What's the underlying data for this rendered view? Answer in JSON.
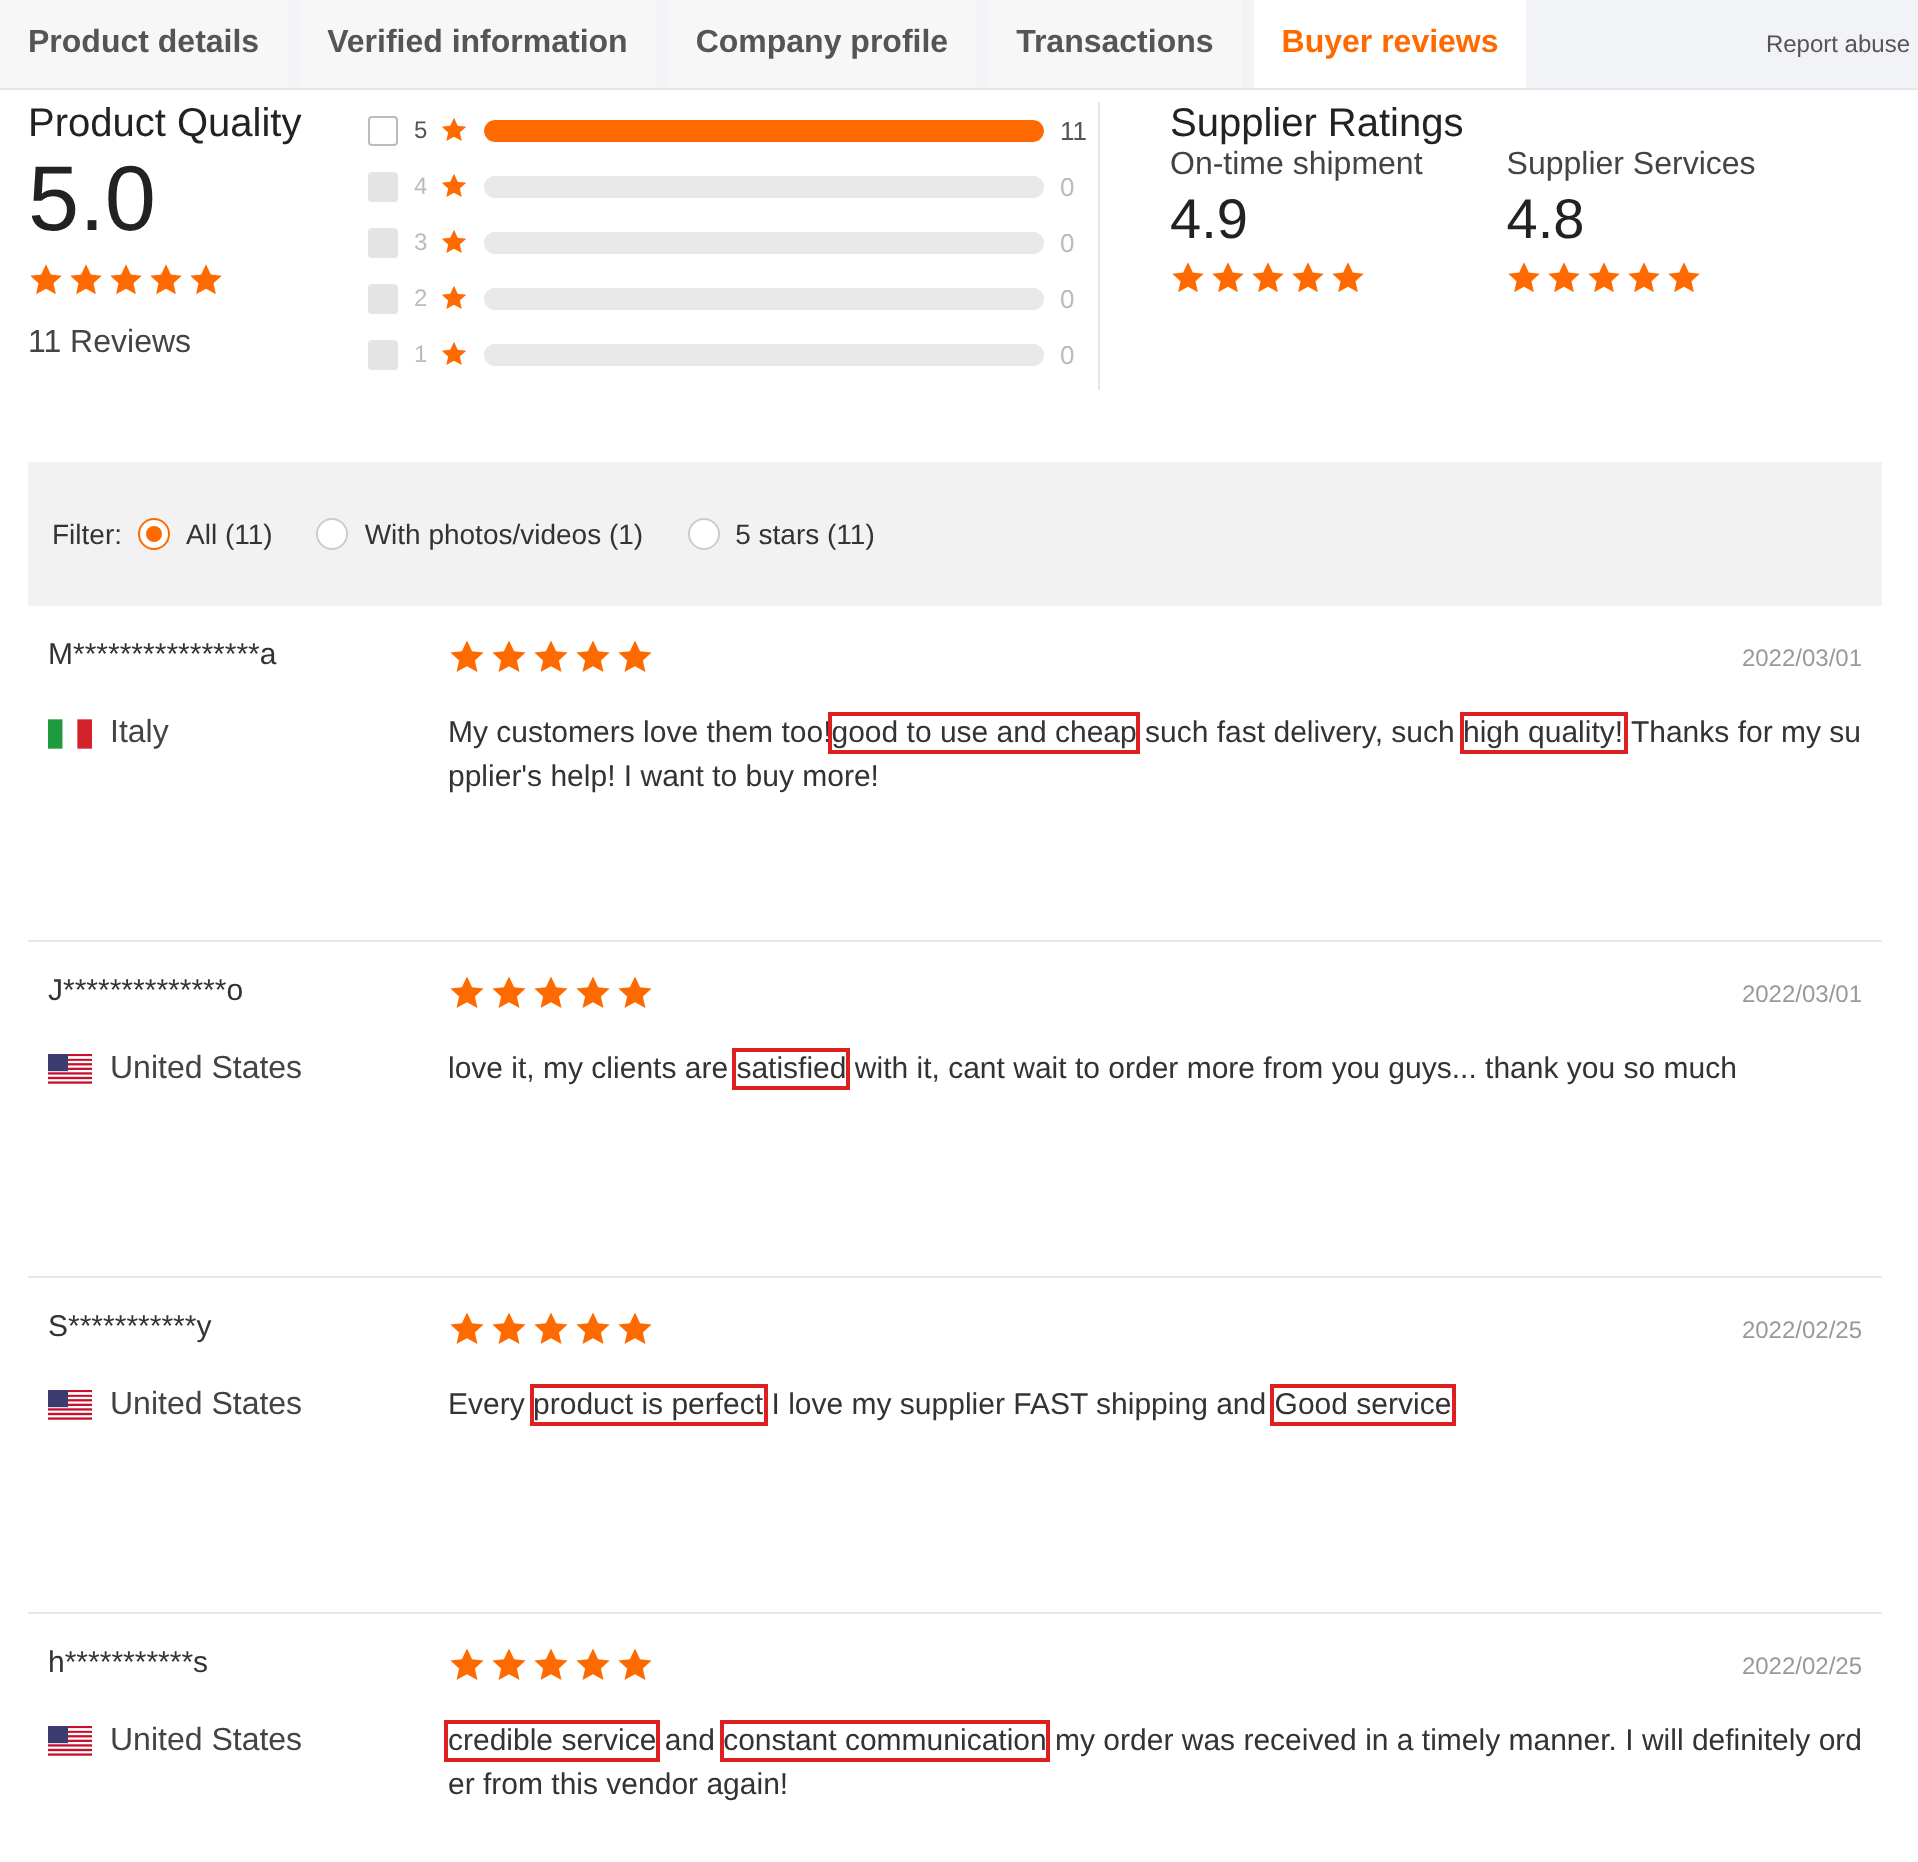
{
  "tabs": [
    {
      "label": "Product details",
      "selected": false
    },
    {
      "label": "Verified information",
      "selected": false
    },
    {
      "label": "Company profile",
      "selected": false
    },
    {
      "label": "Transactions",
      "selected": false
    },
    {
      "label": "Buyer reviews",
      "selected": true
    }
  ],
  "report_link": "Report abuse",
  "product_quality": {
    "title": "Product Quality",
    "score": "5.0",
    "stars": 5,
    "reviews": "11 Reviews"
  },
  "breakdown": [
    {
      "label": "5",
      "checked": false,
      "disabled": false,
      "level": 1,
      "count": "11"
    },
    {
      "label": "4",
      "checked": false,
      "disabled": true,
      "count": "0"
    },
    {
      "label": "3",
      "checked": false,
      "disabled": true,
      "count": "0"
    },
    {
      "label": "2",
      "checked": false,
      "disabled": true,
      "count": "0"
    },
    {
      "label": "1",
      "checked": false,
      "disabled": true,
      "count": "0"
    }
  ],
  "supplier_ratings": {
    "title": "Supplier Ratings",
    "items": [
      {
        "label": "On-time shipment",
        "score": "4.9",
        "stars": 5
      },
      {
        "label": "Supplier Services",
        "score": "4.8",
        "stars": 5
      }
    ]
  },
  "filter": {
    "label": "Filter:",
    "options": [
      {
        "label": "All (11)",
        "selected": true
      },
      {
        "label": "With photos/videos (1)",
        "selected": false
      },
      {
        "label": "5 stars (11)",
        "selected": false
      }
    ]
  },
  "reviews": [
    {
      "name": "M****************a",
      "kind": "italy",
      "country": "Italy",
      "stars": 5,
      "date": "2022/03/01",
      "text": [
        {
          "t": "My customers love them too!",
          "boxed": false
        },
        {
          "t": "good to use and cheap",
          "boxed": true
        },
        {
          "t": " such fast delivery, such ",
          "boxed": false
        },
        {
          "t": "high quality!",
          "boxed": true
        },
        {
          "t": " Thanks for my supplier's help! I want to buy more!",
          "boxed": false
        }
      ]
    },
    {
      "name": "J**************o",
      "kind": "us",
      "country": "United States",
      "stars": 5,
      "date": "2022/03/01",
      "text": [
        {
          "t": "love it, my clients are ",
          "boxed": false
        },
        {
          "t": "satisfied",
          "boxed": true
        },
        {
          "t": " with it, cant wait to order more from you guys... thank you so much",
          "boxed": false
        }
      ]
    },
    {
      "name": "S***********y",
      "kind": "us",
      "country": "United States",
      "stars": 5,
      "date": "2022/02/25",
      "text": [
        {
          "t": "Every ",
          "boxed": false
        },
        {
          "t": "product is perfect",
          "boxed": true
        },
        {
          "t": " I love my supplier FAST shipping and ",
          "boxed": false
        },
        {
          "t": "Good service",
          "boxed": true
        }
      ]
    },
    {
      "name": "h***********s",
      "kind": "us",
      "country": "United States",
      "stars": 5,
      "date": "2022/02/25",
      "text": [
        {
          "t": "credible service",
          "boxed": true
        },
        {
          "t": " and ",
          "boxed": false
        },
        {
          "t": "constant communication",
          "boxed": true
        },
        {
          "t": " my order was received in a timely manner. I will definitely order from this vendor again!",
          "boxed": false
        }
      ]
    }
  ]
}
